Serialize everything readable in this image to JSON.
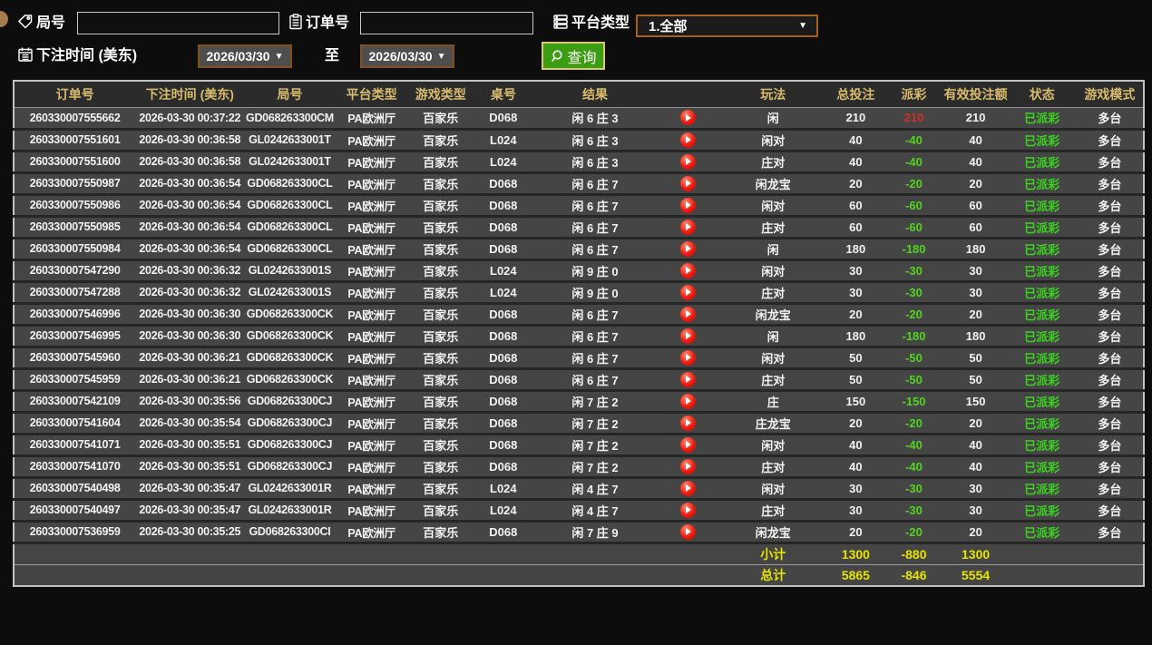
{
  "filters": {
    "round_label": "局号",
    "round_value": "",
    "order_label": "订单号",
    "order_value": "",
    "platform_label": "平台类型",
    "platform_value": "1.全部",
    "time_label": "下注时间 (美东)",
    "date_from": "2026/03/30",
    "date_to": "2026/03/30",
    "to_label": "至",
    "search_label": "查询"
  },
  "icons": {
    "dropdown_arrow": "▼"
  },
  "colors": {
    "search_button_green": "#3c9d12",
    "payout_win_red": "#d03028",
    "payout_loss_green": "#52d41e",
    "status_green": "#3ad41e",
    "footer_yellow": "#e6e300",
    "header_text_tan": "#d9bb6e",
    "date_border_brown": "#84501a"
  },
  "table": {
    "columns": [
      "订单号",
      "下注时间 (美东)",
      "局号",
      "平台类型",
      "游戏类型",
      "桌号",
      "结果",
      "",
      "玩法",
      "总投注",
      "派彩",
      "有效投注额",
      "状态",
      "游戏模式"
    ],
    "rows": [
      {
        "order_no": "260330007555662",
        "bet_time": "2026-03-30 00:37:22",
        "round_no": "GD068263300CM",
        "platform": "PA欧洲厅",
        "game_type": "百家乐",
        "table_no": "D068",
        "result": "闲 6 庄 3",
        "play_type": "闲",
        "total_bet": "210",
        "payout": "210",
        "valid_bet": "210",
        "status": "已派彩",
        "game_mode": "多台"
      },
      {
        "order_no": "260330007551601",
        "bet_time": "2026-03-30 00:36:58",
        "round_no": "GL0242633001T",
        "platform": "PA欧洲厅",
        "game_type": "百家乐",
        "table_no": "L024",
        "result": "闲 6 庄 3",
        "play_type": "闲对",
        "total_bet": "40",
        "payout": "-40",
        "valid_bet": "40",
        "status": "已派彩",
        "game_mode": "多台"
      },
      {
        "order_no": "260330007551600",
        "bet_time": "2026-03-30 00:36:58",
        "round_no": "GL0242633001T",
        "platform": "PA欧洲厅",
        "game_type": "百家乐",
        "table_no": "L024",
        "result": "闲 6 庄 3",
        "play_type": "庄对",
        "total_bet": "40",
        "payout": "-40",
        "valid_bet": "40",
        "status": "已派彩",
        "game_mode": "多台"
      },
      {
        "order_no": "260330007550987",
        "bet_time": "2026-03-30 00:36:54",
        "round_no": "GD068263300CL",
        "platform": "PA欧洲厅",
        "game_type": "百家乐",
        "table_no": "D068",
        "result": "闲 6 庄 7",
        "play_type": "闲龙宝",
        "total_bet": "20",
        "payout": "-20",
        "valid_bet": "20",
        "status": "已派彩",
        "game_mode": "多台"
      },
      {
        "order_no": "260330007550986",
        "bet_time": "2026-03-30 00:36:54",
        "round_no": "GD068263300CL",
        "platform": "PA欧洲厅",
        "game_type": "百家乐",
        "table_no": "D068",
        "result": "闲 6 庄 7",
        "play_type": "闲对",
        "total_bet": "60",
        "payout": "-60",
        "valid_bet": "60",
        "status": "已派彩",
        "game_mode": "多台"
      },
      {
        "order_no": "260330007550985",
        "bet_time": "2026-03-30 00:36:54",
        "round_no": "GD068263300CL",
        "platform": "PA欧洲厅",
        "game_type": "百家乐",
        "table_no": "D068",
        "result": "闲 6 庄 7",
        "play_type": "庄对",
        "total_bet": "60",
        "payout": "-60",
        "valid_bet": "60",
        "status": "已派彩",
        "game_mode": "多台"
      },
      {
        "order_no": "260330007550984",
        "bet_time": "2026-03-30 00:36:54",
        "round_no": "GD068263300CL",
        "platform": "PA欧洲厅",
        "game_type": "百家乐",
        "table_no": "D068",
        "result": "闲 6 庄 7",
        "play_type": "闲",
        "total_bet": "180",
        "payout": "-180",
        "valid_bet": "180",
        "status": "已派彩",
        "game_mode": "多台"
      },
      {
        "order_no": "260330007547290",
        "bet_time": "2026-03-30 00:36:32",
        "round_no": "GL0242633001S",
        "platform": "PA欧洲厅",
        "game_type": "百家乐",
        "table_no": "L024",
        "result": "闲 9 庄 0",
        "play_type": "闲对",
        "total_bet": "30",
        "payout": "-30",
        "valid_bet": "30",
        "status": "已派彩",
        "game_mode": "多台"
      },
      {
        "order_no": "260330007547288",
        "bet_time": "2026-03-30 00:36:32",
        "round_no": "GL0242633001S",
        "platform": "PA欧洲厅",
        "game_type": "百家乐",
        "table_no": "L024",
        "result": "闲 9 庄 0",
        "play_type": "庄对",
        "total_bet": "30",
        "payout": "-30",
        "valid_bet": "30",
        "status": "已派彩",
        "game_mode": "多台"
      },
      {
        "order_no": "260330007546996",
        "bet_time": "2026-03-30 00:36:30",
        "round_no": "GD068263300CK",
        "platform": "PA欧洲厅",
        "game_type": "百家乐",
        "table_no": "D068",
        "result": "闲 6 庄 7",
        "play_type": "闲龙宝",
        "total_bet": "20",
        "payout": "-20",
        "valid_bet": "20",
        "status": "已派彩",
        "game_mode": "多台"
      },
      {
        "order_no": "260330007546995",
        "bet_time": "2026-03-30 00:36:30",
        "round_no": "GD068263300CK",
        "platform": "PA欧洲厅",
        "game_type": "百家乐",
        "table_no": "D068",
        "result": "闲 6 庄 7",
        "play_type": "闲",
        "total_bet": "180",
        "payout": "-180",
        "valid_bet": "180",
        "status": "已派彩",
        "game_mode": "多台"
      },
      {
        "order_no": "260330007545960",
        "bet_time": "2026-03-30 00:36:21",
        "round_no": "GD068263300CK",
        "platform": "PA欧洲厅",
        "game_type": "百家乐",
        "table_no": "D068",
        "result": "闲 6 庄 7",
        "play_type": "闲对",
        "total_bet": "50",
        "payout": "-50",
        "valid_bet": "50",
        "status": "已派彩",
        "game_mode": "多台"
      },
      {
        "order_no": "260330007545959",
        "bet_time": "2026-03-30 00:36:21",
        "round_no": "GD068263300CK",
        "platform": "PA欧洲厅",
        "game_type": "百家乐",
        "table_no": "D068",
        "result": "闲 6 庄 7",
        "play_type": "庄对",
        "total_bet": "50",
        "payout": "-50",
        "valid_bet": "50",
        "status": "已派彩",
        "game_mode": "多台"
      },
      {
        "order_no": "260330007542109",
        "bet_time": "2026-03-30 00:35:56",
        "round_no": "GD068263300CJ",
        "platform": "PA欧洲厅",
        "game_type": "百家乐",
        "table_no": "D068",
        "result": "闲 7 庄 2",
        "play_type": "庄",
        "total_bet": "150",
        "payout": "-150",
        "valid_bet": "150",
        "status": "已派彩",
        "game_mode": "多台"
      },
      {
        "order_no": "260330007541604",
        "bet_time": "2026-03-30 00:35:54",
        "round_no": "GD068263300CJ",
        "platform": "PA欧洲厅",
        "game_type": "百家乐",
        "table_no": "D068",
        "result": "闲 7 庄 2",
        "play_type": "庄龙宝",
        "total_bet": "20",
        "payout": "-20",
        "valid_bet": "20",
        "status": "已派彩",
        "game_mode": "多台"
      },
      {
        "order_no": "260330007541071",
        "bet_time": "2026-03-30 00:35:51",
        "round_no": "GD068263300CJ",
        "platform": "PA欧洲厅",
        "game_type": "百家乐",
        "table_no": "D068",
        "result": "闲 7 庄 2",
        "play_type": "闲对",
        "total_bet": "40",
        "payout": "-40",
        "valid_bet": "40",
        "status": "已派彩",
        "game_mode": "多台"
      },
      {
        "order_no": "260330007541070",
        "bet_time": "2026-03-30 00:35:51",
        "round_no": "GD068263300CJ",
        "platform": "PA欧洲厅",
        "game_type": "百家乐",
        "table_no": "D068",
        "result": "闲 7 庄 2",
        "play_type": "庄对",
        "total_bet": "40",
        "payout": "-40",
        "valid_bet": "40",
        "status": "已派彩",
        "game_mode": "多台"
      },
      {
        "order_no": "260330007540498",
        "bet_time": "2026-03-30 00:35:47",
        "round_no": "GL0242633001R",
        "platform": "PA欧洲厅",
        "game_type": "百家乐",
        "table_no": "L024",
        "result": "闲 4 庄 7",
        "play_type": "闲对",
        "total_bet": "30",
        "payout": "-30",
        "valid_bet": "30",
        "status": "已派彩",
        "game_mode": "多台"
      },
      {
        "order_no": "260330007540497",
        "bet_time": "2026-03-30 00:35:47",
        "round_no": "GL0242633001R",
        "platform": "PA欧洲厅",
        "game_type": "百家乐",
        "table_no": "L024",
        "result": "闲 4 庄 7",
        "play_type": "庄对",
        "total_bet": "30",
        "payout": "-30",
        "valid_bet": "30",
        "status": "已派彩",
        "game_mode": "多台"
      },
      {
        "order_no": "260330007536959",
        "bet_time": "2026-03-30 00:35:25",
        "round_no": "GD068263300CI",
        "platform": "PA欧洲厅",
        "game_type": "百家乐",
        "table_no": "D068",
        "result": "闲 7 庄 9",
        "play_type": "闲龙宝",
        "total_bet": "20",
        "payout": "-20",
        "valid_bet": "20",
        "status": "已派彩",
        "game_mode": "多台"
      }
    ],
    "footer": {
      "subtotal": {
        "label": "小计",
        "total_bet": "1300",
        "payout": "-880",
        "valid_bet": "1300"
      },
      "total": {
        "label": "总计",
        "total_bet": "5865",
        "payout": "-846",
        "valid_bet": "5554"
      }
    }
  }
}
